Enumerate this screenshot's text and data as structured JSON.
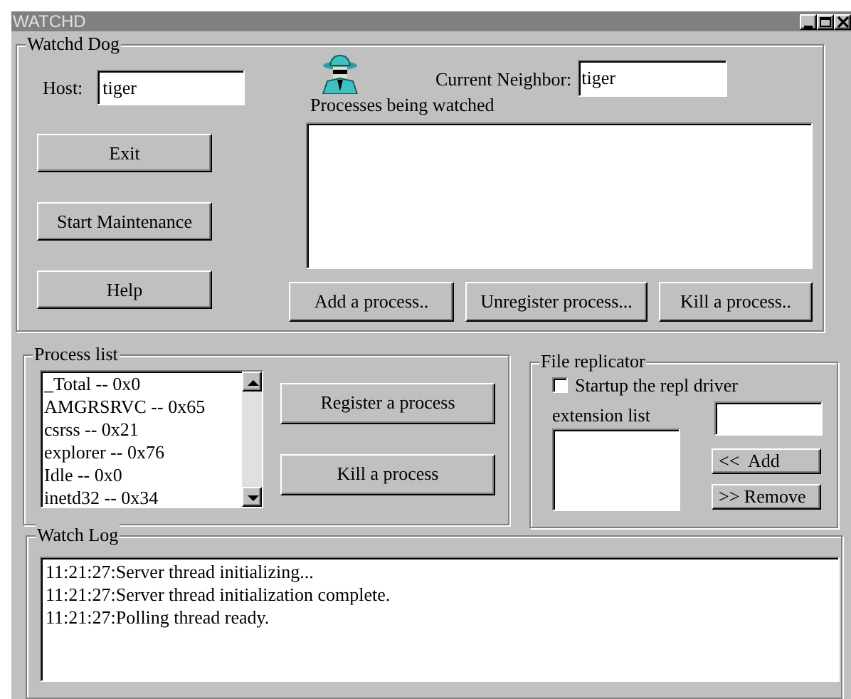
{
  "window": {
    "title": "WATCHD"
  },
  "watchd_dog": {
    "title": "Watchd Dog",
    "host_label": "Host:",
    "host_value": "tiger",
    "neighbor_label": "Current Neighbor:",
    "neighbor_value": "tiger",
    "watched_label": "Processes being watched",
    "side_buttons": [
      "Exit",
      "Start Maintenance",
      "Help"
    ],
    "list_buttons": [
      "Add a process..",
      "Unregister process...",
      "Kill a process.."
    ]
  },
  "process_list": {
    "title": "Process list",
    "items": [
      "_Total -- 0x0",
      "AMGRSRVC -- 0x65",
      "csrss -- 0x21",
      "explorer -- 0x76",
      "Idle -- 0x0",
      "inetd32 -- 0x34"
    ],
    "buttons": [
      "Register a process",
      "Kill a process"
    ]
  },
  "file_replicator": {
    "title": "File replicator",
    "checkbox": {
      "label": "Startup the repl driver",
      "checked": false
    },
    "extension_label": "extension list",
    "buttons": [
      "<<  Add",
      ">> Remove"
    ]
  },
  "watch_log": {
    "title": "Watch Log",
    "lines": [
      "11:21:27:Server thread initializing...",
      "11:21:27:Server thread initialization complete.",
      "11:21:27:Polling thread ready."
    ]
  }
}
